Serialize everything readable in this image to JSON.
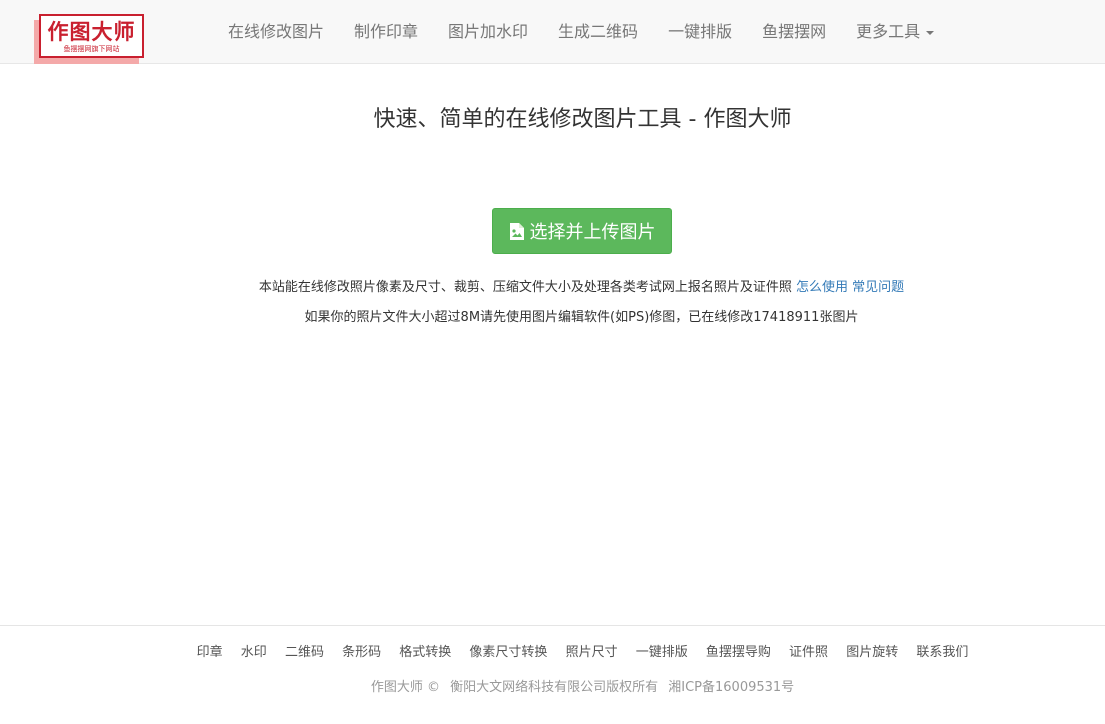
{
  "logo": {
    "title": "作图大师",
    "subtitle": "鱼摆摆网旗下网站",
    "color": "#c9202f"
  },
  "nav": {
    "items": [
      {
        "label": "在线修改图片"
      },
      {
        "label": "制作印章"
      },
      {
        "label": "图片加水印"
      },
      {
        "label": "生成二维码"
      },
      {
        "label": "一键排版"
      },
      {
        "label": "鱼摆摆网"
      },
      {
        "label": "更多工具"
      }
    ],
    "dropdown_icon": "caret-down-icon"
  },
  "main": {
    "title": "快速、简单的在线修改图片工具 - 作图大师",
    "upload_button": {
      "label": "选择并上传图片",
      "icon": "image-file-icon",
      "color": "#5cb85c"
    },
    "info_text": "本站能在线修改照片像素及尺寸、裁剪、压缩文件大小及处理各类考试网上报名照片及证件照",
    "info_link_how": "怎么使用",
    "info_link_faq": "常见问题",
    "notice_text": "如果你的照片文件大小超过8M请先使用图片编辑软件(如PS)修图，已在线修改17418911张图片",
    "link_color": "#337ab7"
  },
  "footer": {
    "links": [
      {
        "label": "印章"
      },
      {
        "label": "水印"
      },
      {
        "label": "二维码"
      },
      {
        "label": "条形码"
      },
      {
        "label": "格式转换"
      },
      {
        "label": "像素尺寸转换"
      },
      {
        "label": "照片尺寸"
      },
      {
        "label": "一键排版"
      },
      {
        "label": "鱼摆摆导购"
      },
      {
        "label": "证件照"
      },
      {
        "label": "图片旋转"
      },
      {
        "label": "联系我们"
      }
    ],
    "brand": "作图大师 ©",
    "company": "衡阳大文网络科技有限公司版权所有",
    "icp": "湘ICP备16009531号"
  }
}
